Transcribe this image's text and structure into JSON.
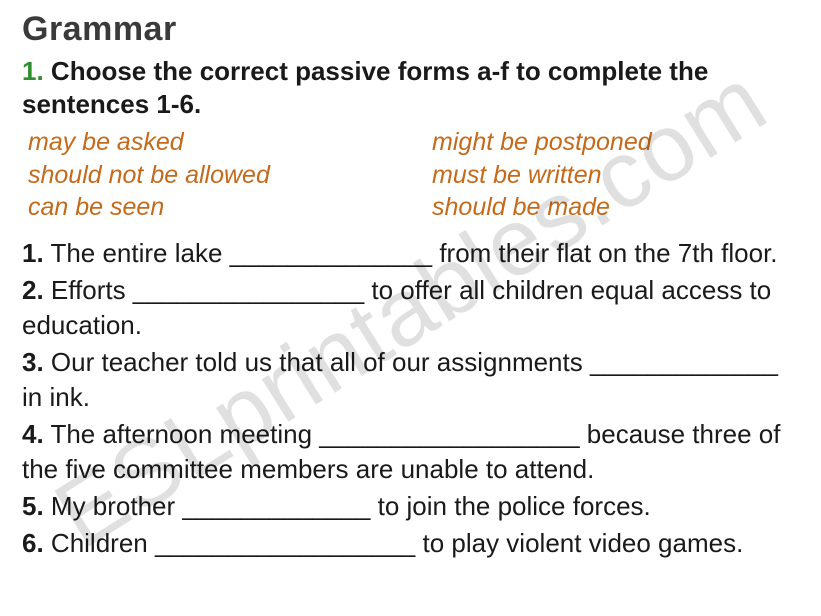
{
  "watermark": "ESLprintables.com",
  "title": "Grammar",
  "instruction_number": "1.",
  "instruction_text": " Choose the correct passive forms a-f to complete the sentences 1-6.",
  "options": {
    "col1": [
      "may be asked",
      "should not be allowed",
      "can be seen"
    ],
    "col2": [
      "might be postponed",
      "must be written",
      "should be made"
    ]
  },
  "sentences": [
    {
      "num": "1.",
      "text_before": " The entire lake ",
      "blank": "______________",
      "text_after": " from their flat on the 7th floor."
    },
    {
      "num": "2.",
      "text_before": " Efforts ",
      "blank": "________________",
      "text_after": " to offer all children equal access to education."
    },
    {
      "num": "3.",
      "text_before": " Our teacher told us that all of our assignments ",
      "blank": "_____________",
      "text_after": " in ink."
    },
    {
      "num": "4.",
      "text_before": " The afternoon meeting ",
      "blank": "__________________",
      "text_after": " because three of the five committee members are unable to attend."
    },
    {
      "num": "5.",
      "text_before": " My brother ",
      "blank": "_____________",
      "text_after": " to join the police forces."
    },
    {
      "num": "6.",
      "text_before": " Children ",
      "blank": "__________________",
      "text_after": " to play violent video games."
    }
  ]
}
